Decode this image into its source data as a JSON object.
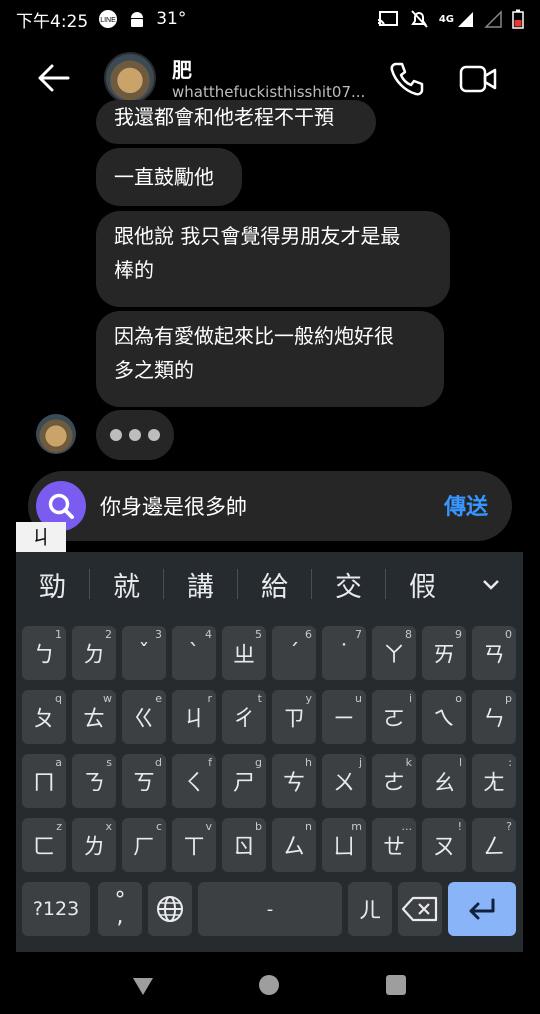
{
  "status_bar": {
    "time": "下午4:25",
    "temperature": "31°",
    "network": "4G"
  },
  "header": {
    "name": "肥",
    "handle": "whatthefuckisthisshit07..."
  },
  "messages": [
    {
      "text": "我還都會和他老程不干預"
    },
    {
      "text": "一直鼓勵他"
    },
    {
      "line1": "跟他說 我只會覺得男朋友才是最",
      "line2": "棒的"
    },
    {
      "line1": "因為有愛做起來比一般約炮好很",
      "line2": "多之類的"
    }
  ],
  "composer": {
    "text": "你身邊是很多帥",
    "send": "傳送"
  },
  "ime": {
    "composing": "ㄐ",
    "candidates": [
      "勁",
      "就",
      "講",
      "給",
      "交",
      "假"
    ]
  },
  "keyboard": {
    "row1": [
      {
        "k": "ㄅ",
        "h": "1"
      },
      {
        "k": "ㄉ",
        "h": "2"
      },
      {
        "k": "ˇ",
        "h": "3"
      },
      {
        "k": "ˋ",
        "h": "4"
      },
      {
        "k": "ㄓ",
        "h": "5"
      },
      {
        "k": "ˊ",
        "h": "6"
      },
      {
        "k": "˙",
        "h": "7"
      },
      {
        "k": "ㄚ",
        "h": "8"
      },
      {
        "k": "ㄞ",
        "h": "9"
      },
      {
        "k": "ㄢ",
        "h": "0"
      }
    ],
    "row2": [
      {
        "k": "ㄆ",
        "h": "q"
      },
      {
        "k": "ㄊ",
        "h": "w"
      },
      {
        "k": "ㄍ",
        "h": "e"
      },
      {
        "k": "ㄐ",
        "h": "r"
      },
      {
        "k": "ㄔ",
        "h": "t"
      },
      {
        "k": "ㄗ",
        "h": "y"
      },
      {
        "k": "ㄧ",
        "h": "u"
      },
      {
        "k": "ㄛ",
        "h": "i"
      },
      {
        "k": "ㄟ",
        "h": "o"
      },
      {
        "k": "ㄣ",
        "h": "p"
      }
    ],
    "row3": [
      {
        "k": "ㄇ",
        "h": "a"
      },
      {
        "k": "ㄋ",
        "h": "s"
      },
      {
        "k": "ㄎ",
        "h": "d"
      },
      {
        "k": "ㄑ",
        "h": "f"
      },
      {
        "k": "ㄕ",
        "h": "g"
      },
      {
        "k": "ㄘ",
        "h": "h"
      },
      {
        "k": "ㄨ",
        "h": "j"
      },
      {
        "k": "ㄜ",
        "h": "k"
      },
      {
        "k": "ㄠ",
        "h": "l"
      },
      {
        "k": "ㄤ",
        "h": ":"
      }
    ],
    "row4": [
      {
        "k": "ㄈ",
        "h": "z"
      },
      {
        "k": "ㄌ",
        "h": "x"
      },
      {
        "k": "ㄏ",
        "h": "c"
      },
      {
        "k": "ㄒ",
        "h": "v"
      },
      {
        "k": "ㄖ",
        "h": "b"
      },
      {
        "k": "ㄙ",
        "h": "n"
      },
      {
        "k": "ㄩ",
        "h": "m"
      },
      {
        "k": "ㄝ",
        "h": "..."
      },
      {
        "k": "ㄡ",
        "h": "!"
      },
      {
        "k": "ㄥ",
        "h": "?"
      }
    ],
    "symbols": "?123",
    "punct_top": "°",
    "punct_bottom": ",",
    "space_label": "-",
    "er": "ㄦ"
  }
}
